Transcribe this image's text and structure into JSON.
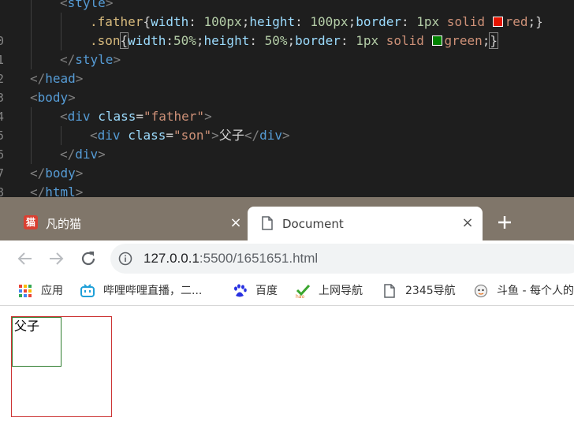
{
  "editor": {
    "lines": [
      {
        "num": "",
        "indent": 2,
        "tokens": [
          {
            "t": "<",
            "c": "punc"
          },
          {
            "t": "style",
            "c": "tag"
          },
          {
            "t": ">",
            "c": "punc"
          }
        ]
      },
      {
        "num": "",
        "indent": 3,
        "tokens": [
          {
            "t": ".father",
            "c": "sel"
          },
          {
            "t": "{",
            "c": "plain"
          },
          {
            "t": "width",
            "c": "prop"
          },
          {
            "t": ": ",
            "c": "plain"
          },
          {
            "t": "100px",
            "c": "num"
          },
          {
            "t": ";",
            "c": "plain"
          },
          {
            "t": "height",
            "c": "prop"
          },
          {
            "t": ": ",
            "c": "plain"
          },
          {
            "t": "100px",
            "c": "num"
          },
          {
            "t": ";",
            "c": "plain"
          },
          {
            "t": "border",
            "c": "prop"
          },
          {
            "t": ": ",
            "c": "plain"
          },
          {
            "t": "1px",
            "c": "num"
          },
          {
            "t": " solid ",
            "c": "val"
          },
          {
            "t": "",
            "c": "swatch-red"
          },
          {
            "t": "red",
            "c": "val"
          },
          {
            "t": ";}",
            "c": "plain"
          }
        ]
      },
      {
        "num": "0",
        "indent": 3,
        "tokens": [
          {
            "t": ".son",
            "c": "sel"
          },
          {
            "t": "{",
            "c": "bracket"
          },
          {
            "t": "width",
            "c": "prop"
          },
          {
            "t": ":",
            "c": "plain"
          },
          {
            "t": "50%",
            "c": "num"
          },
          {
            "t": ";",
            "c": "plain"
          },
          {
            "t": "height",
            "c": "prop"
          },
          {
            "t": ": ",
            "c": "plain"
          },
          {
            "t": "50%",
            "c": "num"
          },
          {
            "t": ";",
            "c": "plain"
          },
          {
            "t": "border",
            "c": "prop"
          },
          {
            "t": ": ",
            "c": "plain"
          },
          {
            "t": "1px",
            "c": "num"
          },
          {
            "t": " solid ",
            "c": "val"
          },
          {
            "t": "",
            "c": "swatch-green"
          },
          {
            "t": "green",
            "c": "val"
          },
          {
            "t": ";",
            "c": "plain"
          },
          {
            "t": "}",
            "c": "bracket"
          }
        ]
      },
      {
        "num": "1",
        "indent": 2,
        "tokens": [
          {
            "t": "</",
            "c": "punc"
          },
          {
            "t": "style",
            "c": "tag"
          },
          {
            "t": ">",
            "c": "punc"
          }
        ]
      },
      {
        "num": "2",
        "indent": 1,
        "tokens": [
          {
            "t": "</",
            "c": "punc"
          },
          {
            "t": "head",
            "c": "tag"
          },
          {
            "t": ">",
            "c": "punc"
          }
        ]
      },
      {
        "num": "3",
        "indent": 1,
        "tokens": [
          {
            "t": "<",
            "c": "punc"
          },
          {
            "t": "body",
            "c": "tag"
          },
          {
            "t": ">",
            "c": "punc"
          }
        ]
      },
      {
        "num": "4",
        "indent": 2,
        "tokens": [
          {
            "t": "<",
            "c": "punc"
          },
          {
            "t": "div",
            "c": "tag"
          },
          {
            "t": " ",
            "c": "plain"
          },
          {
            "t": "class",
            "c": "attr"
          },
          {
            "t": "=",
            "c": "plain"
          },
          {
            "t": "\"father\"",
            "c": "str"
          },
          {
            "t": ">",
            "c": "punc"
          }
        ]
      },
      {
        "num": "5",
        "indent": 3,
        "tokens": [
          {
            "t": "<",
            "c": "punc"
          },
          {
            "t": "div",
            "c": "tag"
          },
          {
            "t": " ",
            "c": "plain"
          },
          {
            "t": "class",
            "c": "attr"
          },
          {
            "t": "=",
            "c": "plain"
          },
          {
            "t": "\"son\"",
            "c": "str"
          },
          {
            "t": ">",
            "c": "punc"
          },
          {
            "t": "父子",
            "c": "plain"
          },
          {
            "t": "</",
            "c": "punc"
          },
          {
            "t": "div",
            "c": "tag"
          },
          {
            "t": ">",
            "c": "punc"
          }
        ]
      },
      {
        "num": "6",
        "indent": 2,
        "tokens": [
          {
            "t": "</",
            "c": "punc"
          },
          {
            "t": "div",
            "c": "tag"
          },
          {
            "t": ">",
            "c": "punc"
          }
        ]
      },
      {
        "num": "7",
        "indent": 1,
        "tokens": [
          {
            "t": "</",
            "c": "punc"
          },
          {
            "t": "body",
            "c": "tag"
          },
          {
            "t": ">",
            "c": "punc"
          }
        ]
      },
      {
        "num": "8",
        "indent": 1,
        "tokens": [
          {
            "t": "</",
            "c": "punc"
          },
          {
            "t": "html",
            "c": "tag"
          },
          {
            "t": ">",
            "c": "punc"
          }
        ]
      }
    ]
  },
  "browser": {
    "tabs": [
      {
        "title": "凡的猫",
        "favicon": "cat-icon",
        "close": "×",
        "active": false
      },
      {
        "title": "Document",
        "favicon": "document-icon",
        "close": "×",
        "active": true
      }
    ],
    "new_tab": "+",
    "url_host": "127.0.0.1",
    "url_rest": ":5500/1651651.html",
    "bookmarks": [
      {
        "label": "应用",
        "icon": "apps-grid-icon"
      },
      {
        "label": "哔哩哔哩直播，二...",
        "icon": "bilibili-icon"
      },
      {
        "label": "百度",
        "icon": "baidu-paw-icon"
      },
      {
        "label": "上网导航",
        "icon": "hao-icon"
      },
      {
        "label": "2345导航",
        "icon": "document-icon"
      },
      {
        "label": "斗鱼 - 每个人的",
        "icon": "douyu-icon"
      }
    ],
    "colors": {
      "tabstrip": "#80766a",
      "accent_red": "#cc3333",
      "accent_green": "#2f7d2f"
    }
  },
  "page": {
    "son_text": "父子"
  }
}
